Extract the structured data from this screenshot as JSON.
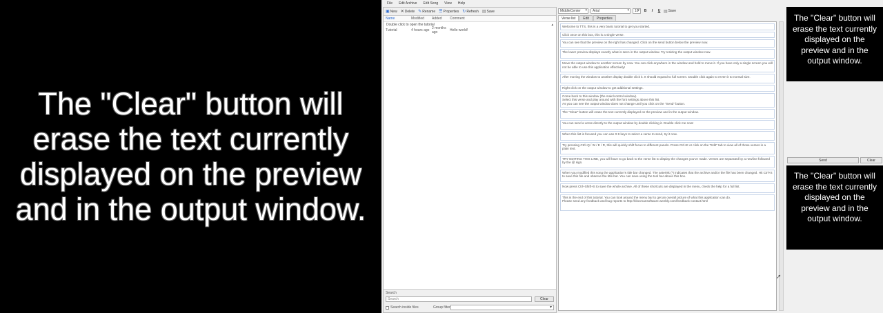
{
  "output_window": {
    "text": "The \"Clear\" button will erase the text currently displayed on the preview and in the output window."
  },
  "menu": [
    "File",
    "Edit Archive",
    "Edit Song",
    "View",
    "Help"
  ],
  "toolbar": {
    "new": "New",
    "delete": "Delete",
    "rename": "Rename",
    "properties": "Properties",
    "refresh": "Refresh",
    "save": "Save"
  },
  "list": {
    "columns": [
      "Name",
      "Modified",
      "Added",
      "Comment"
    ],
    "group_label": "Double click to open the tutorial",
    "rows": [
      {
        "name": "Tutorial",
        "modified": "4 hours ago",
        "added": "2 months ago",
        "comment": "Hello world!"
      }
    ]
  },
  "search": {
    "label": "Search",
    "placeholder": "Search",
    "clear_label": "Clear",
    "mode_label": "Search inside files",
    "group_filter_label": "Group filter"
  },
  "editor": {
    "position_select": "MiddleCenter",
    "font_select": "Arial",
    "size_select": "16",
    "bold": "B",
    "italic": "I",
    "underline": "U",
    "save": "Save",
    "tabs": [
      "Verse list",
      "Edit",
      "Properties"
    ],
    "verses": [
      "Welcome to TTS, this is a very basic tutorial to get you started.",
      "Click once on this box, this is a single verse.",
      "You can see that the preview on the right has changed. Click on the send button below the preview now.",
      "The lower preview displays exactly what is seen in the output window. Try resizing the output window now.",
      "Move the output window to another screen by now. You can click anywhere in the window and hold to move it. If you have only a single screen you will not be able to use this application effectively!",
      "After moving the window to another display double click it. It should expand to full screen. Double click again to revert it to normal size.",
      "Right click on the output window to get additional settings.",
      "Come back to this window (the main/control window).\nSelect this verse and play around with the font settings above this list.\nAs you can see the output window does not change until you click on the \"Send\" button.",
      "The \"Clear\" button will erase the text currently displayed on the preview and in the output window.",
      "You can send a verse directly to the output window by double clicking it. Double click me now!",
      "When this list is focused you can use 0-9 keys to select a verse to send, try it now.",
      "Try pressing Ctrl+Q / W / E / R, this will quickly shift focus to different panels. Press Ctrl+E or click on the \"Edit\" tab to view all of those verses in a plain text.",
      "TRY EDITING THIS LINE, you will have to go back to the verse list to display the changes you've made. Verses are separated by a newline followed by the @ sign.",
      "When you modified this song the application's title bar changed. The asterisk (*) indicates that the archive and/or the file has been changed. Hit Ctrl+S to save this file and observe the title bar. You can save using the tool bar above this box.",
      "Now press Ctrl+Shift+S to save the whole archive. All of these shortcuts are displayed in the menu, check the help for a full list.",
      "This is the end of this tutorial. You can look around the menu bar to get an overall picture of what this application can do.\nPlease send any feedback and bug reports to http://klocmansoftware.weebly.com/feedback-contact.html"
    ]
  },
  "preview": {
    "text": "The \"Clear\" button will erase the text currently displayed on the preview and in the output window."
  },
  "controls": {
    "send": "Send",
    "clear": "Clear"
  },
  "output_preview": {
    "text": "The \"Clear\" button will erase the text currently displayed on the preview and in the output window."
  }
}
